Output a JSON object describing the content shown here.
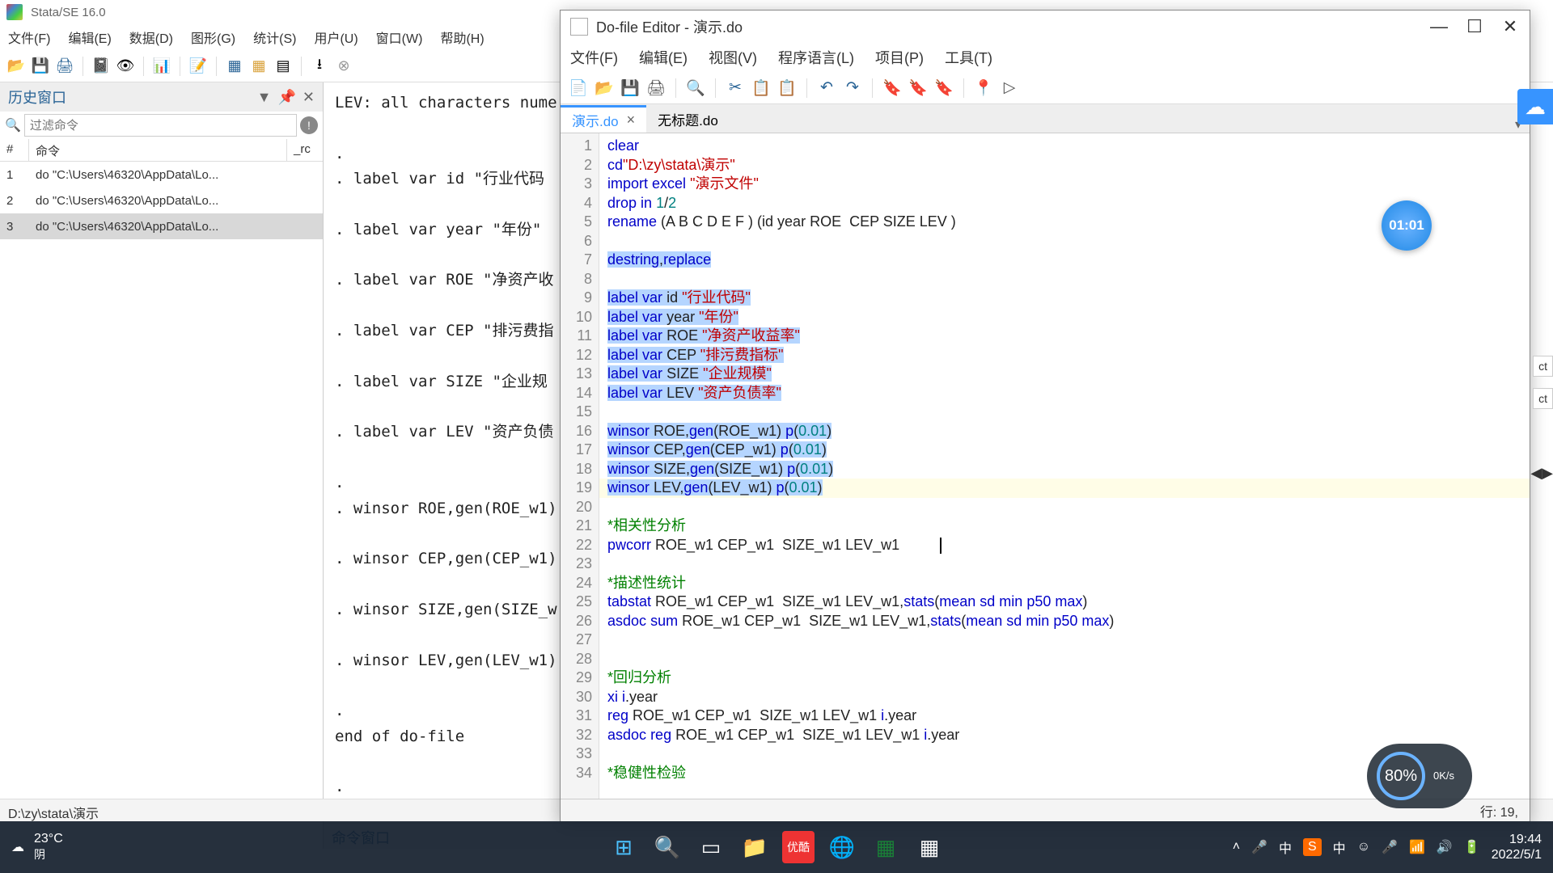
{
  "stata": {
    "title": "Stata/SE 16.0",
    "menu": [
      "文件(F)",
      "编辑(E)",
      "数据(D)",
      "图形(G)",
      "统计(S)",
      "用户(U)",
      "窗口(W)",
      "帮助(H)"
    ],
    "history": {
      "panel_title": "历史窗口",
      "filter_placeholder": "过滤命令",
      "cols": {
        "num": "#",
        "cmd": "命令",
        "rc": "_rc"
      },
      "rows": [
        {
          "n": "1",
          "cmd": "do \"C:\\Users\\46320\\AppData\\Lo..."
        },
        {
          "n": "2",
          "cmd": "do \"C:\\Users\\46320\\AppData\\Lo..."
        },
        {
          "n": "3",
          "cmd": "do \"C:\\Users\\46320\\AppData\\Lo..."
        }
      ]
    },
    "results": "LEV: all characters nume\n\n.\n. label var id \"行业代码\n\n. label var year \"年份\"\n\n. label var ROE \"净资产收\n\n. label var CEP \"排污费指\n\n. label var SIZE \"企业规\n\n. label var LEV \"资产负债\n\n.\n. winsor ROE,gen(ROE_w1)\n\n. winsor CEP,gen(CEP_w1)\n\n. winsor SIZE,gen(SIZE_w\n\n. winsor LEV,gen(LEV_w1)\n\n.\nend of do-file\n\n.",
    "cmd_panel": "命令窗口",
    "statusbar": "D:\\zy\\stata\\演示"
  },
  "dofile": {
    "title": "Do-file Editor - 演示.do",
    "menu": [
      "文件(F)",
      "编辑(E)",
      "视图(V)",
      "程序语言(L)",
      "项目(P)",
      "工具(T)"
    ],
    "tabs": {
      "active": "演示.do",
      "inactive": "无标题.do"
    },
    "status": "行: 19,",
    "current_line": 19,
    "lines": [
      {
        "n": 1,
        "raw": "clear"
      },
      {
        "n": 2,
        "raw": "cd\"D:\\zy\\stata\\演示\""
      },
      {
        "n": 3,
        "raw": "import excel \"演示文件\""
      },
      {
        "n": 4,
        "raw": "drop in 1/2"
      },
      {
        "n": 5,
        "raw": "rename (A B C D E F ) (id year ROE  CEP SIZE LEV )"
      },
      {
        "n": 6,
        "raw": ""
      },
      {
        "n": 7,
        "raw": "destring,replace"
      },
      {
        "n": 8,
        "raw": ""
      },
      {
        "n": 9,
        "raw": "label var id \"行业代码\""
      },
      {
        "n": 10,
        "raw": "label var year \"年份\""
      },
      {
        "n": 11,
        "raw": "label var ROE \"净资产收益率\""
      },
      {
        "n": 12,
        "raw": "label var CEP \"排污费指标\""
      },
      {
        "n": 13,
        "raw": "label var SIZE \"企业规模\""
      },
      {
        "n": 14,
        "raw": "label var LEV \"资产负债率\""
      },
      {
        "n": 15,
        "raw": ""
      },
      {
        "n": 16,
        "raw": "winsor ROE,gen(ROE_w1) p(0.01)"
      },
      {
        "n": 17,
        "raw": "winsor CEP,gen(CEP_w1) p(0.01)"
      },
      {
        "n": 18,
        "raw": "winsor SIZE,gen(SIZE_w1) p(0.01)"
      },
      {
        "n": 19,
        "raw": "winsor LEV,gen(LEV_w1) p(0.01)"
      },
      {
        "n": 20,
        "raw": ""
      },
      {
        "n": 21,
        "raw": "*相关性分析"
      },
      {
        "n": 22,
        "raw": "pwcorr ROE_w1 CEP_w1  SIZE_w1 LEV_w1"
      },
      {
        "n": 23,
        "raw": ""
      },
      {
        "n": 24,
        "raw": "*描述性统计"
      },
      {
        "n": 25,
        "raw": "tabstat ROE_w1 CEP_w1  SIZE_w1 LEV_w1,stats(mean sd min p50 max)"
      },
      {
        "n": 26,
        "raw": "asdoc sum ROE_w1 CEP_w1  SIZE_w1 LEV_w1,stats(mean sd min p50 max)"
      },
      {
        "n": 27,
        "raw": ""
      },
      {
        "n": 28,
        "raw": ""
      },
      {
        "n": 29,
        "raw": "*回归分析"
      },
      {
        "n": 30,
        "raw": "xi i.year"
      },
      {
        "n": 31,
        "raw": "reg ROE_w1 CEP_w1  SIZE_w1 LEV_w1 i.year"
      },
      {
        "n": 32,
        "raw": "asdoc reg ROE_w1 CEP_w1  SIZE_w1 LEV_w1 i.year"
      },
      {
        "n": 33,
        "raw": ""
      },
      {
        "n": 34,
        "raw": "*稳健性检验"
      }
    ]
  },
  "taskbar": {
    "weather_temp": "23°C",
    "weather_cond": "阴",
    "ime": "中",
    "time": "19:44",
    "date": "2022/5/1"
  },
  "overlays": {
    "timer": "01:01",
    "gauge_pct": "80%",
    "gauge_net": "0K/s"
  }
}
